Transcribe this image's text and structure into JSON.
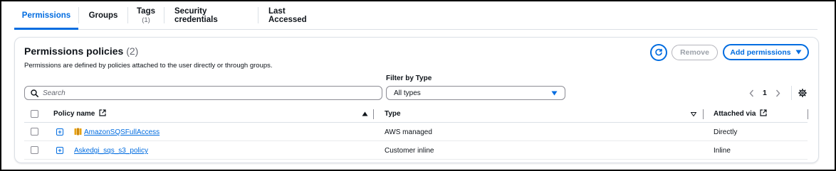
{
  "tabs": [
    {
      "label": "Permissions",
      "sub": ""
    },
    {
      "label": "Groups",
      "sub": ""
    },
    {
      "label": "Tags",
      "sub": "(1)"
    },
    {
      "label": "Security credentials",
      "sub": ""
    },
    {
      "label": "Last Accessed",
      "sub": ""
    }
  ],
  "panel": {
    "title": "Permissions policies",
    "count": "(2)",
    "description": "Permissions are defined by policies attached to the user directly or through groups.",
    "remove_label": "Remove",
    "add_label": "Add permissions",
    "filter_label": "Filter by Type",
    "search_placeholder": "Search",
    "filter_value": "All types",
    "page": "1"
  },
  "table": {
    "headers": {
      "name": "Policy name",
      "type": "Type",
      "attached": "Attached via"
    },
    "rows": [
      {
        "name": "AmazonSQSFullAccess",
        "type": "AWS managed",
        "attached": "Directly"
      },
      {
        "name": "Askedgi_sqs_s3_policy",
        "type": "Customer inline",
        "attached": "Inline"
      }
    ]
  },
  "colors": {
    "accent": "#006ce0",
    "sqs_icon": "#e7a214"
  },
  "icons": [
    "refresh-icon",
    "caret-down-icon",
    "search-icon",
    "chevron-left-icon",
    "chevron-right-icon",
    "settings-icon",
    "external-link-icon",
    "expand-icon",
    "sqs-service-icon",
    "sort-ascending-icon",
    "sort-descending-icon"
  ]
}
